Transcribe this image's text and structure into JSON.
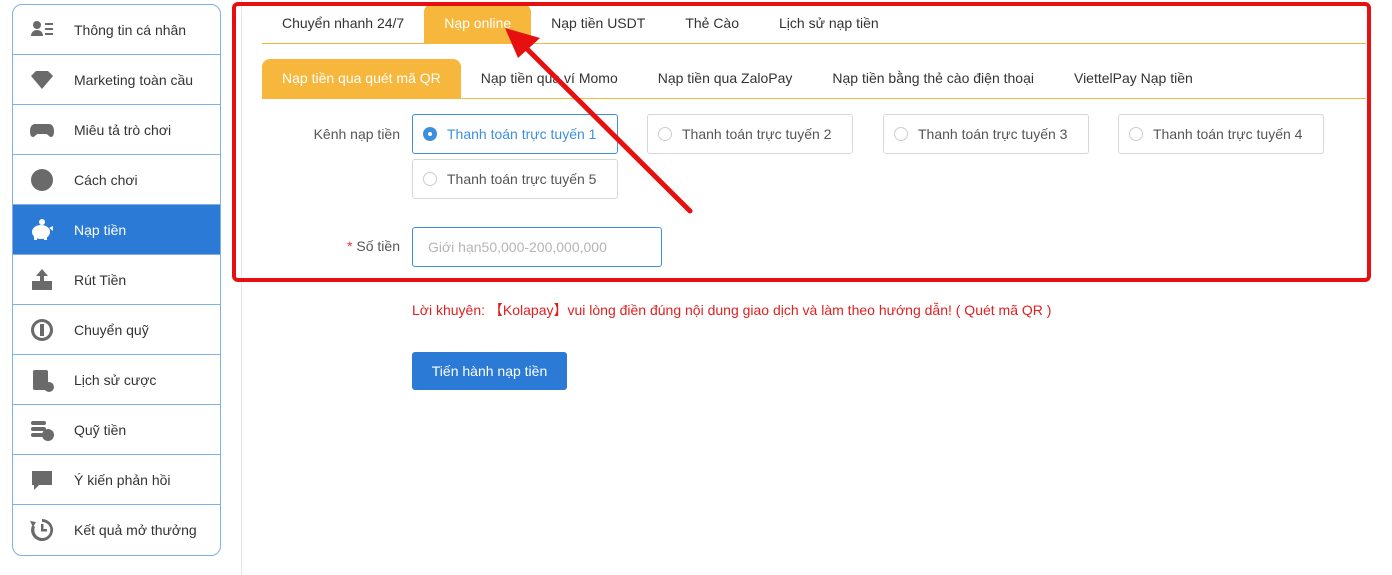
{
  "sidebar": {
    "items": [
      {
        "label": "Thông tin cá nhân",
        "icon": "profile-card-icon"
      },
      {
        "label": "Marketing toàn cầu",
        "icon": "diamond-icon"
      },
      {
        "label": "Miêu tả trò chơi",
        "icon": "gamepad-icon"
      },
      {
        "label": "Cách chơi",
        "icon": "info-icon"
      },
      {
        "label": "Nạp tiền",
        "icon": "piggy-bank-icon",
        "active": true
      },
      {
        "label": "Rút Tiền",
        "icon": "withdraw-icon"
      },
      {
        "label": "Chuyển quỹ",
        "icon": "transfer-icon"
      },
      {
        "label": "Lịch sử cược",
        "icon": "bet-history-icon"
      },
      {
        "label": "Quỹ tiền",
        "icon": "coins-icon"
      },
      {
        "label": "Ý kiến phản hồi",
        "icon": "chat-bubble-icon"
      },
      {
        "label": "Kết quả mở thưởng",
        "icon": "history-clock-icon"
      }
    ]
  },
  "tabs": [
    {
      "label": "Chuyển nhanh 24/7"
    },
    {
      "label": "Nạp online",
      "active": true
    },
    {
      "label": "Nạp tiền USDT"
    },
    {
      "label": "Thẻ Cào"
    },
    {
      "label": "Lịch sử nạp tiền"
    }
  ],
  "subtabs": [
    {
      "label": "Nạp tiền qua quét mã QR",
      "active": true
    },
    {
      "label": "Nạp tiền qua ví Momo"
    },
    {
      "label": "Nạp tiền qua ZaloPay"
    },
    {
      "label": "Nạp tiền bằng thẻ cào điện thoại"
    },
    {
      "label": "ViettelPay Nạp tiền"
    }
  ],
  "form": {
    "channel_label": "Kênh nạp tiền",
    "channels": [
      {
        "label": "Thanh toán trực tuyến 1",
        "selected": true
      },
      {
        "label": "Thanh toán trực tuyến 2"
      },
      {
        "label": "Thanh toán trực tuyến 3"
      },
      {
        "label": "Thanh toán trực tuyến 4"
      },
      {
        "label": "Thanh toán trực tuyến 5"
      }
    ],
    "required_mark": "*",
    "amount_label": "Số tiền",
    "amount_placeholder": "Giới hạn50,000-200,000,000",
    "amount_value": ""
  },
  "advice": "Lời khuyên: 【Kolapay】vui lòng điền đúng nội dung giao dịch và làm theo hướng dẫn! ( Quét mã QR )",
  "submit_label": "Tiến hành nạp tiền",
  "colors": {
    "accent_orange": "#f6b73c",
    "primary_blue": "#2a7ad6",
    "annotation_red": "#e61010",
    "advice_red": "#e02020"
  }
}
